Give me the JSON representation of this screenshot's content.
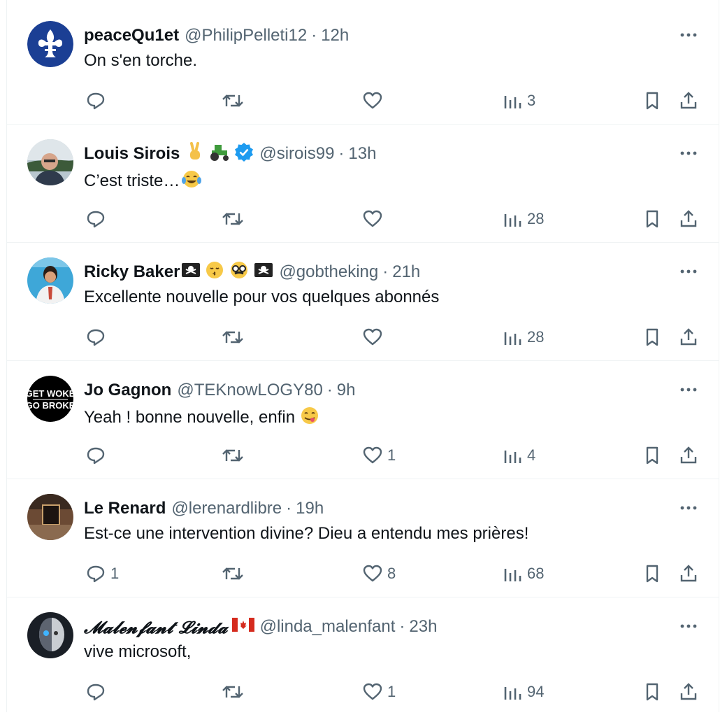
{
  "colors": {
    "text": "#0f1419",
    "muted": "#536471",
    "divider": "#eff3f4",
    "verified": "#1d9bf0"
  },
  "tweets": [
    {
      "name": "peaceQu1et",
      "handle": "@PhilipPelleti12",
      "time": "12h",
      "text": "On s'en torche.",
      "replies": "",
      "likes": "",
      "views": "3",
      "avatar": "fleur-de-lis-avatar"
    },
    {
      "name": "Louis Sirois",
      "handle": "@sirois99",
      "time": "13h",
      "text": "C’est triste…",
      "replies": "",
      "likes": "",
      "views": "28",
      "avatar": "man-photo-avatar",
      "verified": true,
      "name_emojis": [
        "victory-hand-emoji",
        "tractor-emoji"
      ],
      "text_emoji": "tears-of-joy-emoji"
    },
    {
      "name": "Ricky Baker",
      "handle": "@gobtheking",
      "time": "21h",
      "text": "Excellente nouvelle pour vos quelques abonnés",
      "replies": "",
      "likes": "",
      "views": "28",
      "avatar": "person-photo-avatar",
      "name_emojis": [
        "pirate-flag-emoji",
        "kissing-face-emoji",
        "disguised-face-emoji",
        "pirate-flag-emoji"
      ]
    },
    {
      "name": "Jo Gagnon",
      "handle": "@TEKnowLOGY80",
      "time": "9h",
      "text": "Yeah ! bonne nouvelle, enfin",
      "replies": "",
      "likes": "1",
      "views": "4",
      "avatar": "get-woke-go-broke-avatar",
      "avatar_text": [
        "GET WOKE",
        "GO BROKE"
      ],
      "text_emoji": "yum-face-emoji"
    },
    {
      "name": "Le Renard",
      "handle": "@lerenardlibre",
      "time": "19h",
      "text": "Est-ce une intervention divine? Dieu a entendu mes prières!",
      "replies": "1",
      "likes": "8",
      "views": "68",
      "avatar": "room-photo-avatar"
    },
    {
      "name": "𝓜𝓪𝓵𝓮𝓷𝓯𝓪𝓷𝓽 𝓛𝓲𝓷𝓭𝓪",
      "handle": "@linda_malenfant",
      "time": "23h",
      "text": "vive microsoft,",
      "replies": "",
      "likes": "1",
      "views": "94",
      "avatar": "robot-face-avatar",
      "name_emojis": [
        "canada-flag-emoji"
      ]
    }
  ]
}
